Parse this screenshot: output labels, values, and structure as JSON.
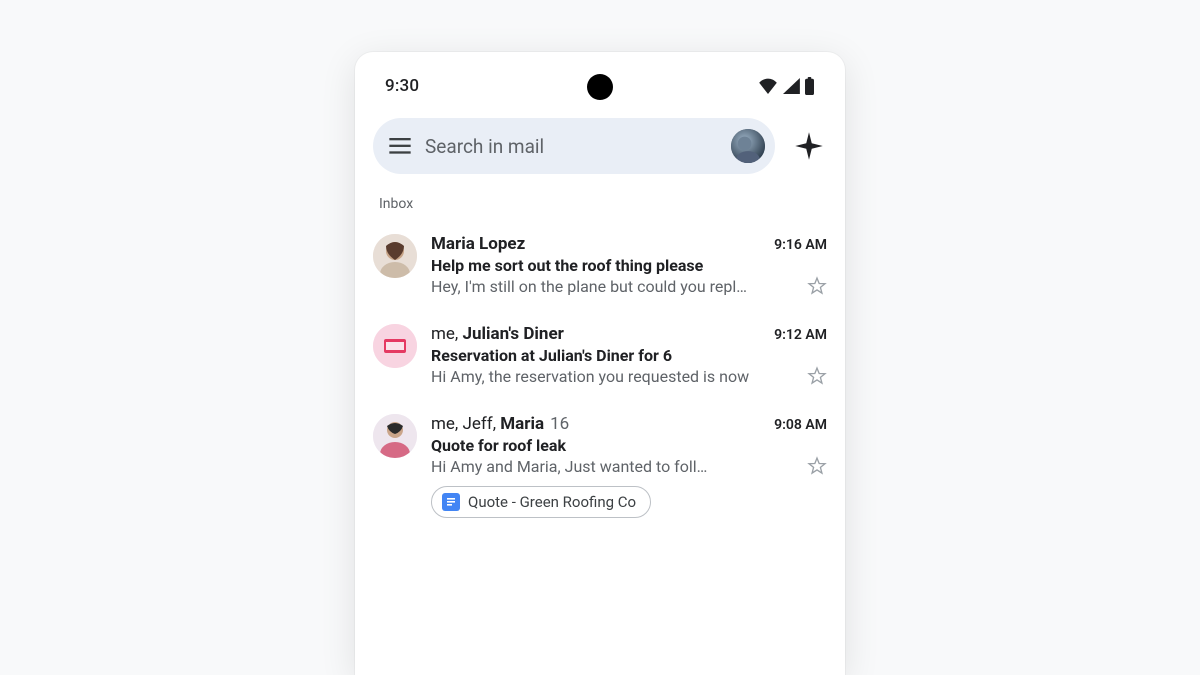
{
  "statusbar": {
    "time": "9:30"
  },
  "search": {
    "placeholder": "Search in mail"
  },
  "section_label": "Inbox",
  "emails": [
    {
      "senders_html": "<span class='b'>Maria Lopez</span>",
      "time": "9:16 AM",
      "subject": "Help me sort out the roof thing please",
      "snippet": "Hey, I'm still on the plane but could you repl…",
      "avatar_color": "#d7ccc8"
    },
    {
      "senders_html": "me, <span class='b'>Julian's Diner</span>",
      "time": "9:12 AM",
      "subject": "Reservation at Julian's Diner for 6",
      "snippet": "Hi Amy, the reservation you requested is now",
      "avatar_color": "#f8bbd0"
    },
    {
      "senders_html": "me, Jeff, <span class='b'>Maria</span><span class='count'>16</span>",
      "time": "9:08 AM",
      "subject": "Quote for roof leak",
      "snippet": "Hi Amy and Maria, Just wanted to foll…",
      "avatar_color": "#e1bee7",
      "attachment": {
        "label": "Quote - Green Roofing Co"
      }
    }
  ]
}
